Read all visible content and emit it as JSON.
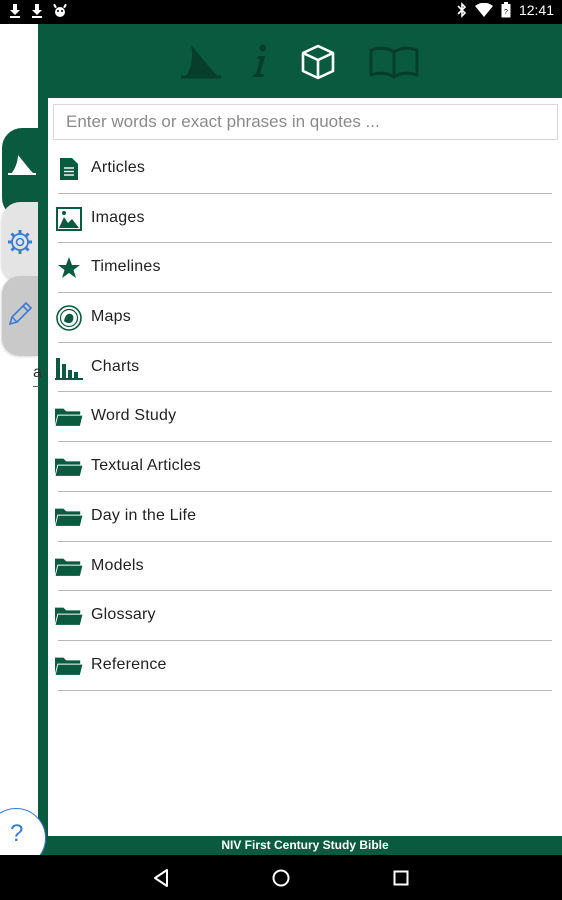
{
  "status_bar": {
    "time": "12:41",
    "left_icons": [
      "download-icon",
      "download-icon",
      "android-debug-icon"
    ],
    "right_icons": [
      "bluetooth-icon",
      "wifi-icon",
      "battery-icon"
    ]
  },
  "header": {
    "icons": [
      "shark-fin-icon",
      "info-icon",
      "cube-icon",
      "open-book-icon"
    ],
    "active": "cube-icon"
  },
  "search": {
    "placeholder": "Enter words or exact phrases in quotes ..."
  },
  "list": [
    {
      "label": "Articles",
      "icon": "document-icon"
    },
    {
      "label": "Images",
      "icon": "image-icon"
    },
    {
      "label": "Timelines",
      "icon": "star-icon"
    },
    {
      "label": "Maps",
      "icon": "map-seal-icon"
    },
    {
      "label": "Charts",
      "icon": "bar-chart-icon"
    },
    {
      "label": "Word Study",
      "icon": "folder-icon"
    },
    {
      "label": "Textual Articles",
      "icon": "folder-icon"
    },
    {
      "label": "Day in the Life",
      "icon": "folder-icon"
    },
    {
      "label": "Models",
      "icon": "folder-icon"
    },
    {
      "label": "Glossary",
      "icon": "folder-icon"
    },
    {
      "label": "Reference",
      "icon": "folder-icon"
    }
  ],
  "side_tabs": [
    "shark-fin-icon",
    "gear-icon",
    "pencil-icon"
  ],
  "ghost_text": "a",
  "help": {
    "symbol": "?"
  },
  "footer": {
    "title": "NIV First Century Study Bible"
  },
  "nav": [
    "back-icon",
    "home-icon",
    "recents-icon"
  ],
  "colors": {
    "brand_green": "#0a5a3f",
    "accent_blue": "#3a7bd5"
  }
}
